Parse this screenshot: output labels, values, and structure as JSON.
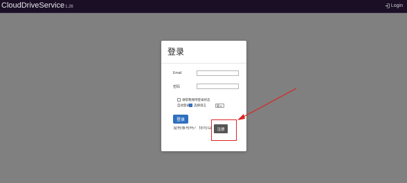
{
  "header": {
    "brand": "CloudDriveService",
    "brand_sub": "1.26",
    "login_link": "Login",
    "login_icon": "sign-in-icon"
  },
  "login_modal": {
    "title": "登录",
    "email_label": "Email",
    "email_value": "",
    "password_label": "密码",
    "password_value": "",
    "remember_text": "请帮我保持登录状态",
    "auto_login_text": "自动登录",
    "language_text": "选择语言",
    "language_value": "简",
    "submit_button": "登录",
    "no_account_text": "没有账号吗？ 你可以",
    "register_button": "注册"
  },
  "annotation": {
    "highlight_color": "#dd2222"
  }
}
